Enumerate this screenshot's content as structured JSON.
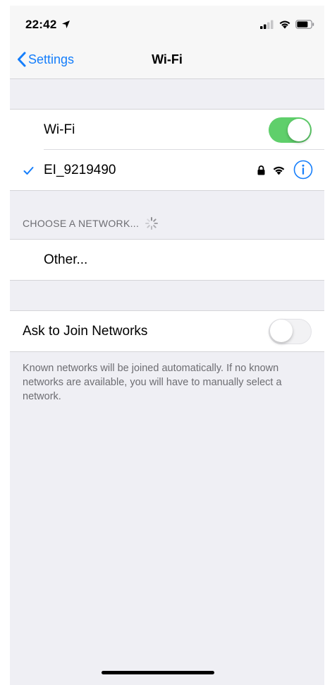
{
  "status_bar": {
    "time": "22:42"
  },
  "nav": {
    "back_label": "Settings",
    "title": "Wi-Fi"
  },
  "wifi": {
    "label": "Wi-Fi",
    "enabled": true
  },
  "connected_network": {
    "name": "EI_9219490",
    "secured": true,
    "connected": true
  },
  "choose_section": {
    "header": "CHOOSE A NETWORK..."
  },
  "other": {
    "label": "Other..."
  },
  "ask_to_join": {
    "label": "Ask to Join Networks",
    "enabled": false,
    "footer": "Known networks will be joined automatically. If no known networks are available, you will have to manually select a network."
  },
  "colors": {
    "accent": "#157efb",
    "toggle_on": "#5fcf6b",
    "background": "#efeff4"
  }
}
